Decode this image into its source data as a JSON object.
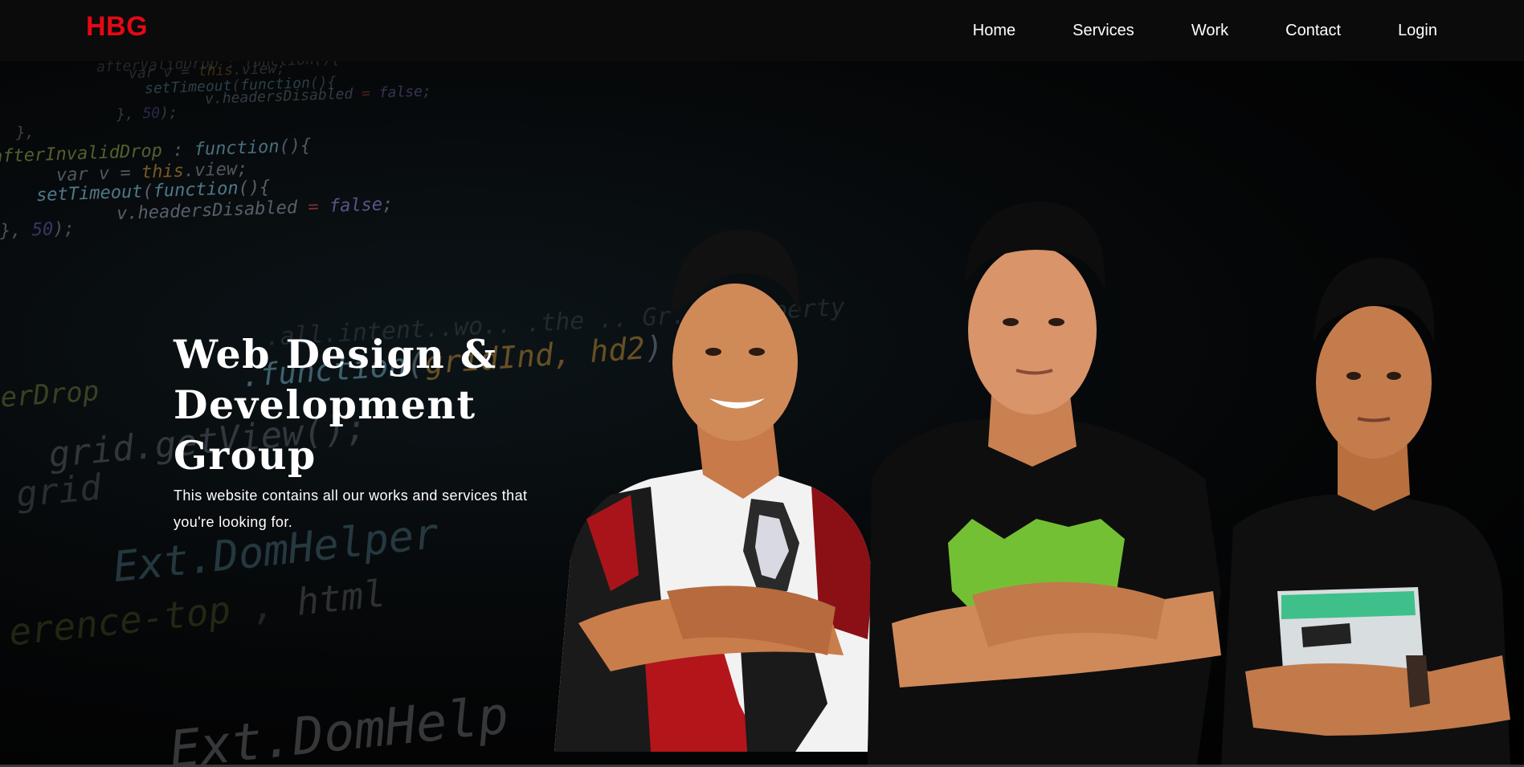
{
  "brand": {
    "logo": "HBG",
    "logo_color": "#e50914"
  },
  "nav": {
    "items": [
      {
        "label": "Home"
      },
      {
        "label": "Services"
      },
      {
        "label": "Work"
      },
      {
        "label": "Contact"
      },
      {
        "label": "Login"
      }
    ]
  },
  "hero": {
    "title": "Web Design & Development Group",
    "subtitle": "This website contains all our works and services that you're looking for.",
    "background_image": "code-background-with-three-people"
  },
  "colors": {
    "navbar_bg": "#0b0b0b",
    "hero_bg": "#000000",
    "text": "#ffffff"
  }
}
